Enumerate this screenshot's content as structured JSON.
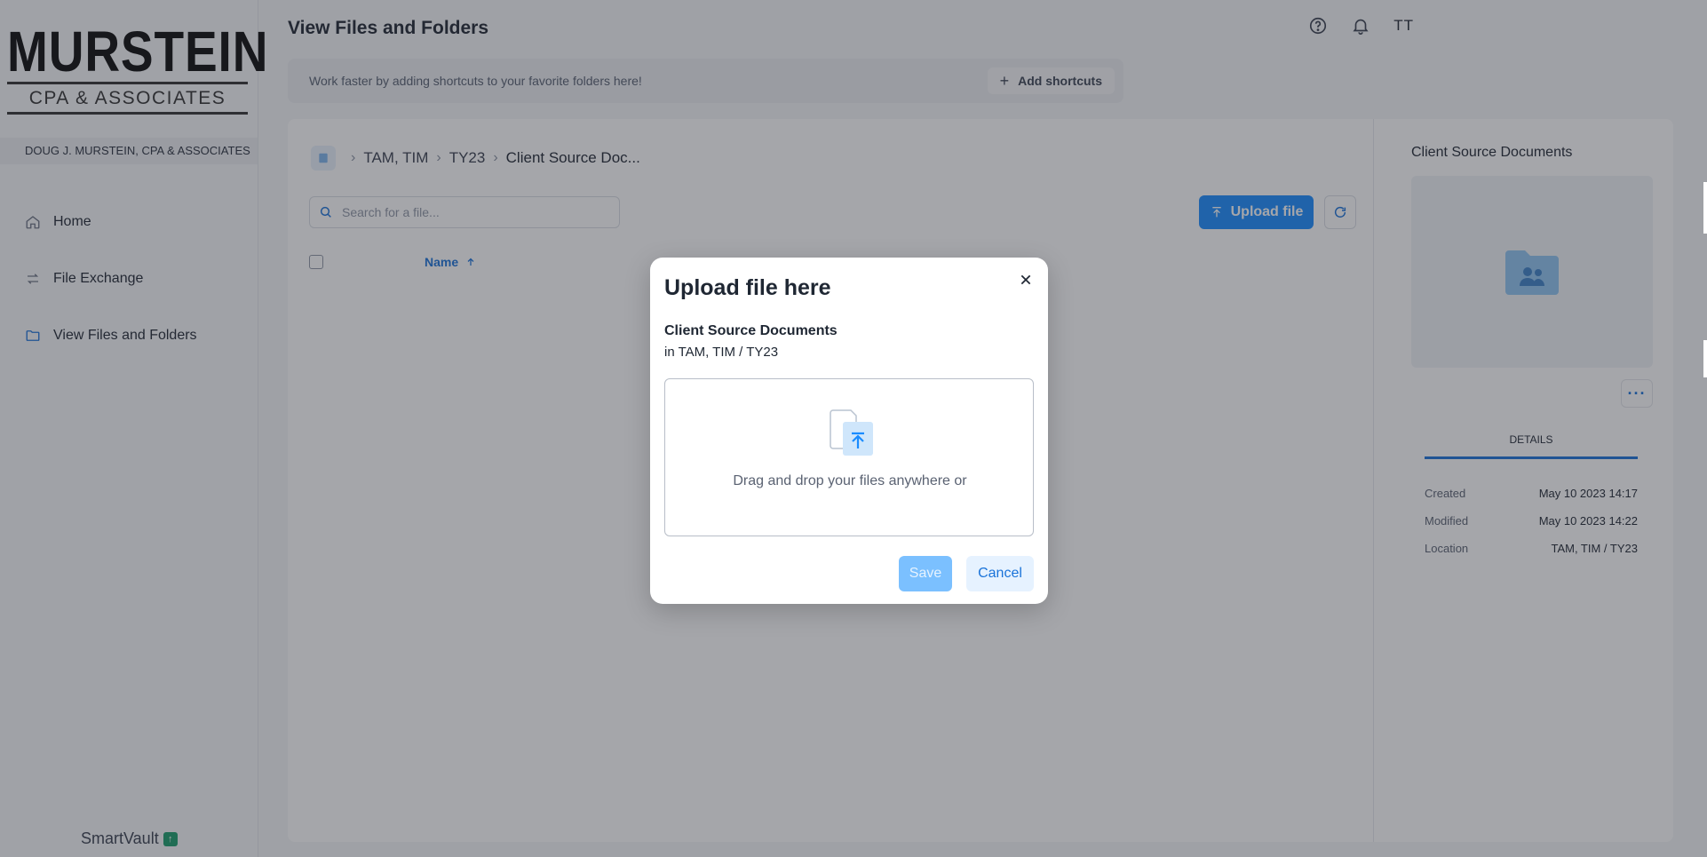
{
  "logo": {
    "main": "MURSTEIN",
    "sub": "CPA & ASSOCIATES"
  },
  "sidebar": {
    "firm_name": "DOUG J. MURSTEIN, CPA & ASSOCIATES",
    "items": [
      {
        "label": "Home",
        "icon": "home-icon"
      },
      {
        "label": "File Exchange",
        "icon": "exchange-icon"
      },
      {
        "label": "View Files and Folders",
        "icon": "folder-icon"
      }
    ],
    "brand": "SmartVault"
  },
  "header": {
    "title": "View Files and Folders",
    "avatar": "TT",
    "help_icon": "help-icon",
    "bell_icon": "bell-icon"
  },
  "shortcuts": {
    "text": "Work faster by adding shortcuts to your favorite folders here!",
    "button": "Add shortcuts"
  },
  "breadcrumb": {
    "items": [
      "TAM, TIM",
      "TY23"
    ],
    "current": "Client Source Doc..."
  },
  "search": {
    "placeholder": "Search for a file..."
  },
  "toolbar": {
    "upload_label": "Upload file"
  },
  "table": {
    "name_header": "Name"
  },
  "details": {
    "title": "Client Source Documents",
    "tab": "DETAILS",
    "rows": [
      {
        "k": "Created",
        "v": "May 10 2023 14:17"
      },
      {
        "k": "Modified",
        "v": "May 10 2023 14:22"
      },
      {
        "k": "Location",
        "v": "TAM, TIM / TY23"
      }
    ]
  },
  "modal": {
    "title": "Upload file here",
    "folder": "Client Source Documents",
    "path": "in TAM, TIM / TY23",
    "dropzone_text": "Drag and drop your files anywhere or",
    "save": "Save",
    "cancel": "Cancel"
  },
  "colors": {
    "accent": "#1a8cff",
    "link": "#1a73d9",
    "brand_green": "#1a9e6c"
  }
}
